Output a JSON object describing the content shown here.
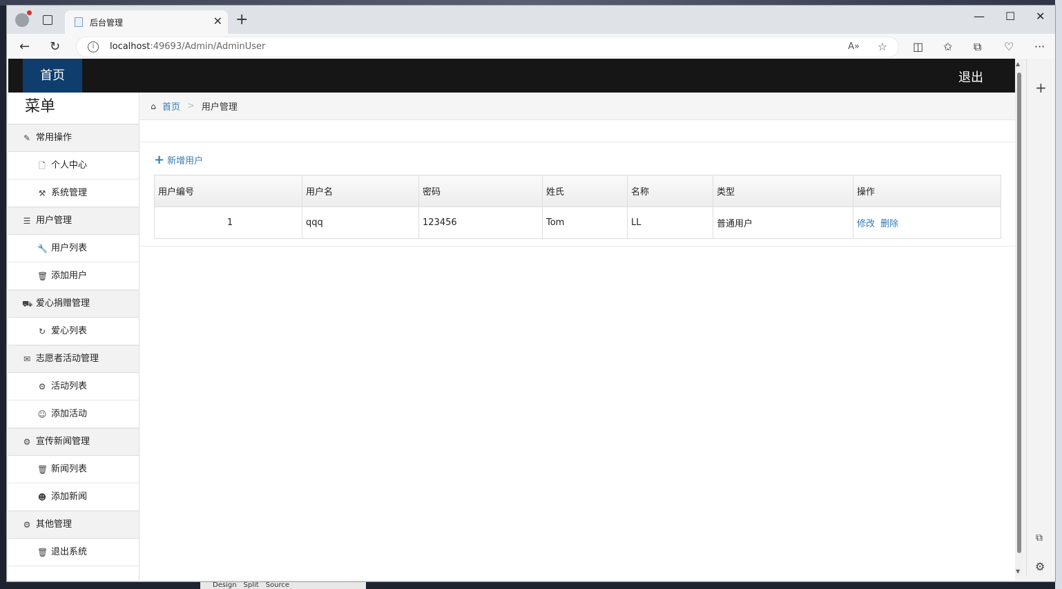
{
  "browser": {
    "tab_title": "后台管理",
    "url_host": "localhost",
    "url_path": ":49693/Admin/AdminUser"
  },
  "topnav": {
    "home": "首页",
    "logout": "退出"
  },
  "sidebar": {
    "title": "菜单",
    "groups": [
      {
        "label": "常用操作",
        "icon": "edit-icon",
        "items": [
          {
            "label": "个人中心",
            "icon": "file-icon"
          },
          {
            "label": "系统管理",
            "icon": "wrench-icon"
          }
        ]
      },
      {
        "label": "用户管理",
        "icon": "list-icon",
        "items": [
          {
            "label": "用户列表",
            "icon": "wrench-icon"
          },
          {
            "label": "添加用户",
            "icon": "trash-icon"
          }
        ]
      },
      {
        "label": "爱心捐赠管理",
        "icon": "road-icon",
        "items": [
          {
            "label": "爱心列表",
            "icon": "refresh-icon"
          }
        ]
      },
      {
        "label": "志愿者活动管理",
        "icon": "envelope-icon",
        "items": [
          {
            "label": "活动列表",
            "icon": "cog-icon"
          },
          {
            "label": "添加活动",
            "icon": "smile-icon"
          }
        ]
      },
      {
        "label": "宣传新闻管理",
        "icon": "cog-icon",
        "items": [
          {
            "label": "新闻列表",
            "icon": "trash-icon"
          },
          {
            "label": "添加新闻",
            "icon": "user-circle-icon"
          }
        ]
      },
      {
        "label": "其他管理",
        "icon": "cog-icon",
        "items": [
          {
            "label": "退出系统",
            "icon": "trash-icon"
          }
        ]
      }
    ]
  },
  "breadcrumb": {
    "home": "首页",
    "separator": ">",
    "current": "用户管理"
  },
  "main": {
    "add_user": "新增用户",
    "table": {
      "headers": [
        "用户编号",
        "用户名",
        "密码",
        "姓氏",
        "名称",
        "类型",
        "操作"
      ],
      "rows": [
        {
          "id": "1",
          "username": "qqq",
          "password": "123456",
          "surname": "Tom",
          "name": "LL",
          "type": "普通用户",
          "edit": "修改",
          "delete": "删除"
        }
      ]
    }
  },
  "taskbar": {
    "design": "Design",
    "split": "Split",
    "source": "Source"
  }
}
